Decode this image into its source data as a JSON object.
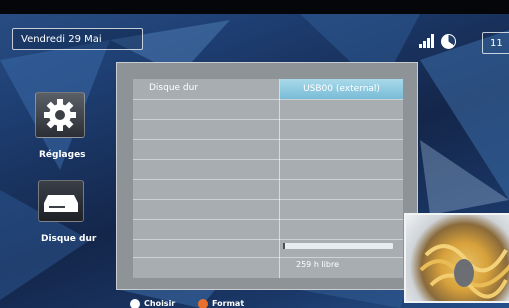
{
  "header": {
    "date": "Vendredi 29 Mai",
    "clock": "11",
    "icons": [
      "signal-strength-icon",
      "pie-timer-icon"
    ]
  },
  "sidebar": {
    "items": [
      {
        "label": "Réglages",
        "icon": "gear-icon"
      },
      {
        "label": "Disque dur",
        "icon": "hard-drive-icon"
      }
    ]
  },
  "panel": {
    "left_header": "Disque dur",
    "right_header": "USB00 (external)",
    "capacity_used_fraction": 0.02,
    "free_text": "259 h libre"
  },
  "footer": {
    "hints": [
      {
        "label": "Choisir",
        "color": "#ffffff"
      },
      {
        "label": "Format",
        "color": "#e8702a"
      }
    ]
  },
  "colors": {
    "accent_highlight": "#8ccbe0",
    "panel_bg": "#a7adb1"
  }
}
